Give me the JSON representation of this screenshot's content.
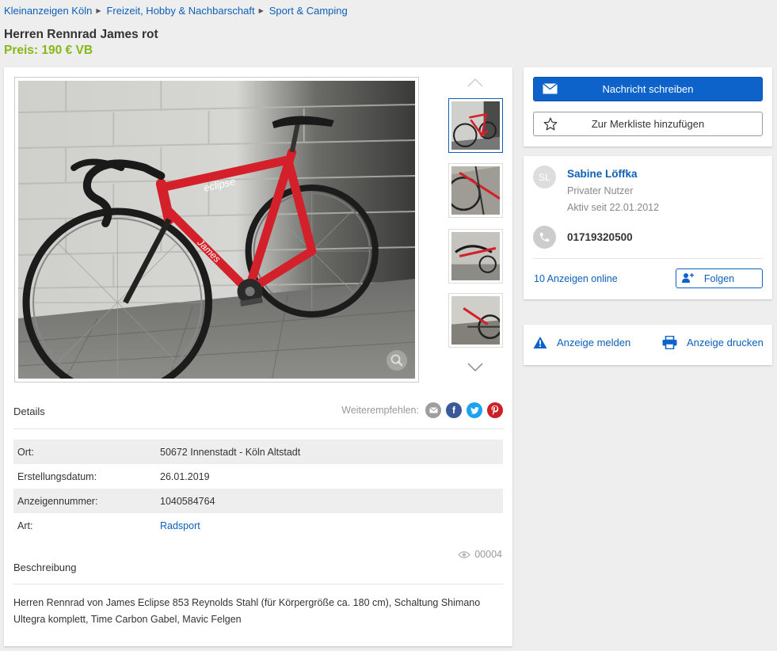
{
  "breadcrumb": [
    {
      "label": "Kleinanzeigen Köln"
    },
    {
      "label": "Freizeit, Hobby & Nachbarschaft"
    },
    {
      "label": "Sport & Camping"
    }
  ],
  "listing": {
    "title": "Herren Rennrad James rot",
    "price": "Preis: 190 € VB"
  },
  "gallery": {
    "thumbnail_count": 4,
    "active_thumbnail": 0
  },
  "details": {
    "heading": "Details",
    "share_label": "Weiterempfehlen:",
    "share_icons": [
      "email-icon",
      "facebook-icon",
      "twitter-icon",
      "pinterest-icon"
    ],
    "rows": [
      {
        "key": "Ort:",
        "value": "50672 Innenstadt - Köln Altstadt"
      },
      {
        "key": "Erstellungsdatum:",
        "value": "26.01.2019"
      },
      {
        "key": "Anzeigennummer:",
        "value": "1040584764"
      },
      {
        "key": "Art:",
        "value": "Radsport"
      }
    ]
  },
  "views": "00004",
  "description": {
    "heading": "Beschreibung",
    "text": "Herren Rennrad von James Eclipse 853 Reynolds Stahl (für Körpergröße ca. 180 cm), Schaltung Shimano Ultegra komplett, Time Carbon Gabel, Mavic Felgen"
  },
  "actions": {
    "message_label": "Nachricht schreiben",
    "watchlist_label": "Zur Merkliste hinzufügen"
  },
  "seller": {
    "initials": "SL",
    "name": "Sabine Löffka",
    "type": "Privater Nutzer",
    "active_since": "Aktiv seit 22.01.2012",
    "phone": "01719320500",
    "ads_online": "10 Anzeigen online",
    "follow_label": "Folgen"
  },
  "tools": {
    "report_label": "Anzeige melden",
    "print_label": "Anzeige drucken"
  },
  "colors": {
    "link": "#0d5fb8",
    "price": "#86b817",
    "primary_button": "#0d63c9",
    "facebook": "#3b5998",
    "twitter": "#1da1f2",
    "pinterest": "#cb2027",
    "email": "#9e9e9e"
  }
}
